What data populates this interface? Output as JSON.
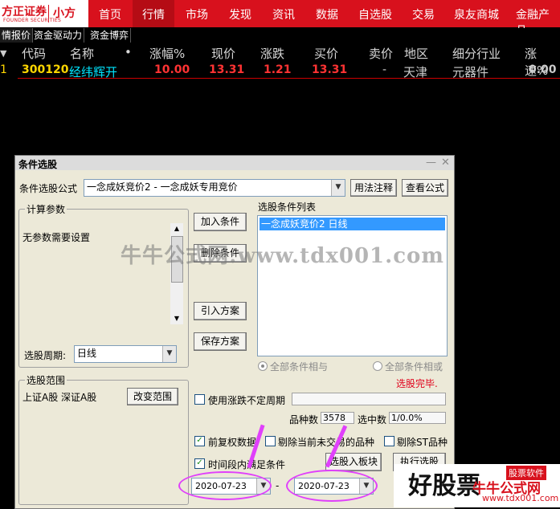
{
  "app": {
    "logo_brand": "方正证券",
    "logo_sub": "FOUNDER SECURITIES",
    "logo_small": "小方"
  },
  "nav": [
    "首页",
    "行情",
    "市场",
    "发现",
    "资讯",
    "数据",
    "自选股",
    "交易",
    "泉友商城",
    "金融产品"
  ],
  "subtabs": [
    "情报价",
    "资金驱动力",
    "资金博弈"
  ],
  "table": {
    "headers": [
      "代码",
      "名称",
      "•",
      "涨幅%",
      "现价",
      "涨跌",
      "买价",
      "卖价",
      "地区",
      "细分行业",
      "涨速%"
    ],
    "row": {
      "index": "1",
      "code": "300120",
      "name": "经纬辉开",
      "change_pct": "10.00",
      "price": "13.31",
      "change": "1.21",
      "bid": "13.31",
      "ask": "-",
      "region": "天津",
      "industry": "元器件",
      "speed": "0.00"
    }
  },
  "dialog": {
    "title": "条件选股",
    "formula_label": "条件选股公式",
    "formula_value": "一念成妖竞价2 - 一念成妖专用竞价",
    "usage_btn": "用法注释",
    "view_btn": "查看公式",
    "calc_group": "计算参数",
    "no_params": "无参数需要设置",
    "period_label": "选股周期:",
    "period_value": "日线",
    "scope_group": "选股范围",
    "scope_value": "上证A股 深证A股",
    "change_scope_btn": "改变范围",
    "add_cond_btn": "加入条件",
    "del_cond_btn": "删除条件",
    "import_btn": "引入方案",
    "save_btn": "保存方案",
    "cond_list_label": "选股条件列表",
    "cond_item": "一念成妖竞价2  日线",
    "radio_and": "全部条件相与",
    "radio_or": "全部条件相或",
    "status": "选股完毕.",
    "use_period": "使用涨跌不定周期",
    "count_label": "品种数",
    "count_value": "3578",
    "hit_label": "选中数",
    "hit_value": "1/0.0%",
    "pre_adjust": "前复权数据",
    "exclude_suspend": "剔除当前未交易的品种",
    "exclude_st": "剔除ST品种",
    "time_range": "时间段内满足条件",
    "to_block_btn": "选股入板块",
    "exec_btn": "执行选股",
    "date_from": "2020-07-23",
    "date_to": "2020-07-23",
    "dash": "-"
  },
  "watermark": {
    "text": "牛牛公式网:www.tdx001.com",
    "big": "好股票",
    "small": "股票软件",
    "red": "牛牛公式网",
    "url": "www.tdx001.com"
  },
  "colors": {
    "topbar": "#d8111d",
    "code_yellow": "#ffd700",
    "name_cyan": "#00e5ff",
    "up_red": "#ff3333",
    "dialog_bg": "#ece9d8",
    "highlight": "#e040fb"
  }
}
